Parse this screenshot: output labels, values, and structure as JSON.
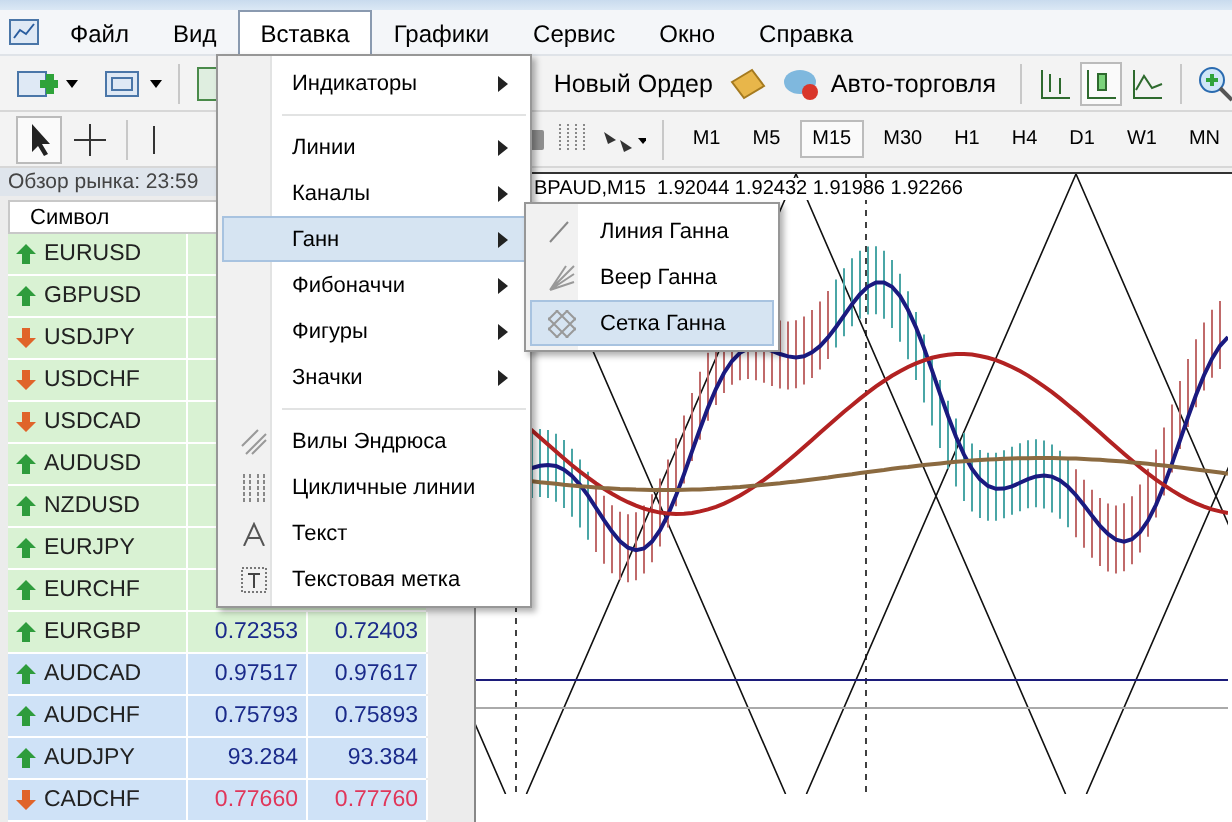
{
  "menubar": [
    {
      "label": "Файл",
      "selected": false
    },
    {
      "label": "Вид",
      "selected": false
    },
    {
      "label": "Вставка",
      "selected": true
    },
    {
      "label": "Графики",
      "selected": false
    },
    {
      "label": "Сервис",
      "selected": false
    },
    {
      "label": "Окно",
      "selected": false
    },
    {
      "label": "Справка",
      "selected": false
    }
  ],
  "toolbar": {
    "buttons": [
      {
        "label": "Новый Ордер"
      },
      {
        "label": "Авто-торговля"
      }
    ]
  },
  "timeframes": [
    {
      "label": "M1",
      "selected": false
    },
    {
      "label": "M5",
      "selected": false
    },
    {
      "label": "M15",
      "selected": true
    },
    {
      "label": "M30",
      "selected": false
    },
    {
      "label": "H1",
      "selected": false
    },
    {
      "label": "H4",
      "selected": false
    },
    {
      "label": "D1",
      "selected": false
    },
    {
      "label": "W1",
      "selected": false
    },
    {
      "label": "MN",
      "selected": false
    }
  ],
  "market_watch": {
    "title": "Обзор рынка: 23:59",
    "columns": [
      "Символ"
    ],
    "rows": [
      {
        "symbol": "EURUSD",
        "rising": true,
        "color": "#d9f2d3"
      },
      {
        "symbol": "GBPUSD",
        "rising": true,
        "color": "#d9f2d3"
      },
      {
        "symbol": "USDJPY",
        "rising": false,
        "color": "#d9f2d3"
      },
      {
        "symbol": "USDCHF",
        "rising": false,
        "color": "#d9f2d3"
      },
      {
        "symbol": "USDCAD",
        "rising": false,
        "color": "#d9f2d3"
      },
      {
        "symbol": "AUDUSD",
        "rising": true,
        "color": "#d9f2d3"
      },
      {
        "symbol": "NZDUSD",
        "rising": true,
        "color": "#d9f2d3"
      },
      {
        "symbol": "EURJPY",
        "rising": true,
        "color": "#d9f2d3"
      },
      {
        "symbol": "EURCHF",
        "rising": true,
        "color": "#d9f2d3"
      },
      {
        "symbol": "EURGBP",
        "rising": true,
        "color": "#d9f2d3",
        "bid": "0.72353",
        "ask": "0.72403"
      },
      {
        "symbol": "AUDCAD",
        "rising": true,
        "color": "#cfe2f7",
        "bid": "0.97517",
        "ask": "0.97617"
      },
      {
        "symbol": "AUDCHF",
        "rising": true,
        "color": "#cfe2f7",
        "bid": "0.75793",
        "ask": "0.75893"
      },
      {
        "symbol": "AUDJPY",
        "rising": true,
        "color": "#cfe2f7",
        "bid": "93.284",
        "ask": "93.384"
      },
      {
        "symbol": "CADCHF",
        "rising": false,
        "color": "#cfe2f7",
        "bid": "0.77660",
        "ask": "0.77760"
      }
    ]
  },
  "chart": {
    "header": "BPAUD,M15  1.92044 1.92432 1.91986 1.92266"
  },
  "insert_menu": {
    "groups": [
      [
        {
          "label": "Индикаторы",
          "kind": "submenu",
          "selected": false
        }
      ],
      [
        {
          "label": "Линии",
          "kind": "submenu",
          "selected": false
        },
        {
          "label": "Каналы",
          "kind": "submenu",
          "selected": false
        },
        {
          "label": "Ганн",
          "kind": "submenu",
          "selected": true
        },
        {
          "label": "Фибоначчи",
          "kind": "submenu",
          "selected": false
        },
        {
          "label": "Фигуры",
          "kind": "submenu",
          "selected": false
        },
        {
          "label": "Значки",
          "kind": "submenu",
          "selected": false
        }
      ],
      [
        {
          "label": "Вилы Эндрюса",
          "kind": "pitchfork",
          "selected": false
        },
        {
          "label": "Цикличные линии",
          "kind": "cycles",
          "selected": false
        },
        {
          "label": "Текст",
          "kind": "text",
          "selected": false
        },
        {
          "label": "Текстовая метка",
          "kind": "label",
          "selected": false
        }
      ]
    ]
  },
  "gann_submenu": [
    {
      "label": "Линия Ганна",
      "kind": "line",
      "selected": false
    },
    {
      "label": "Веер Ганна",
      "kind": "fan",
      "selected": false
    },
    {
      "label": "Сетка Ганна",
      "kind": "grid",
      "selected": true
    }
  ]
}
